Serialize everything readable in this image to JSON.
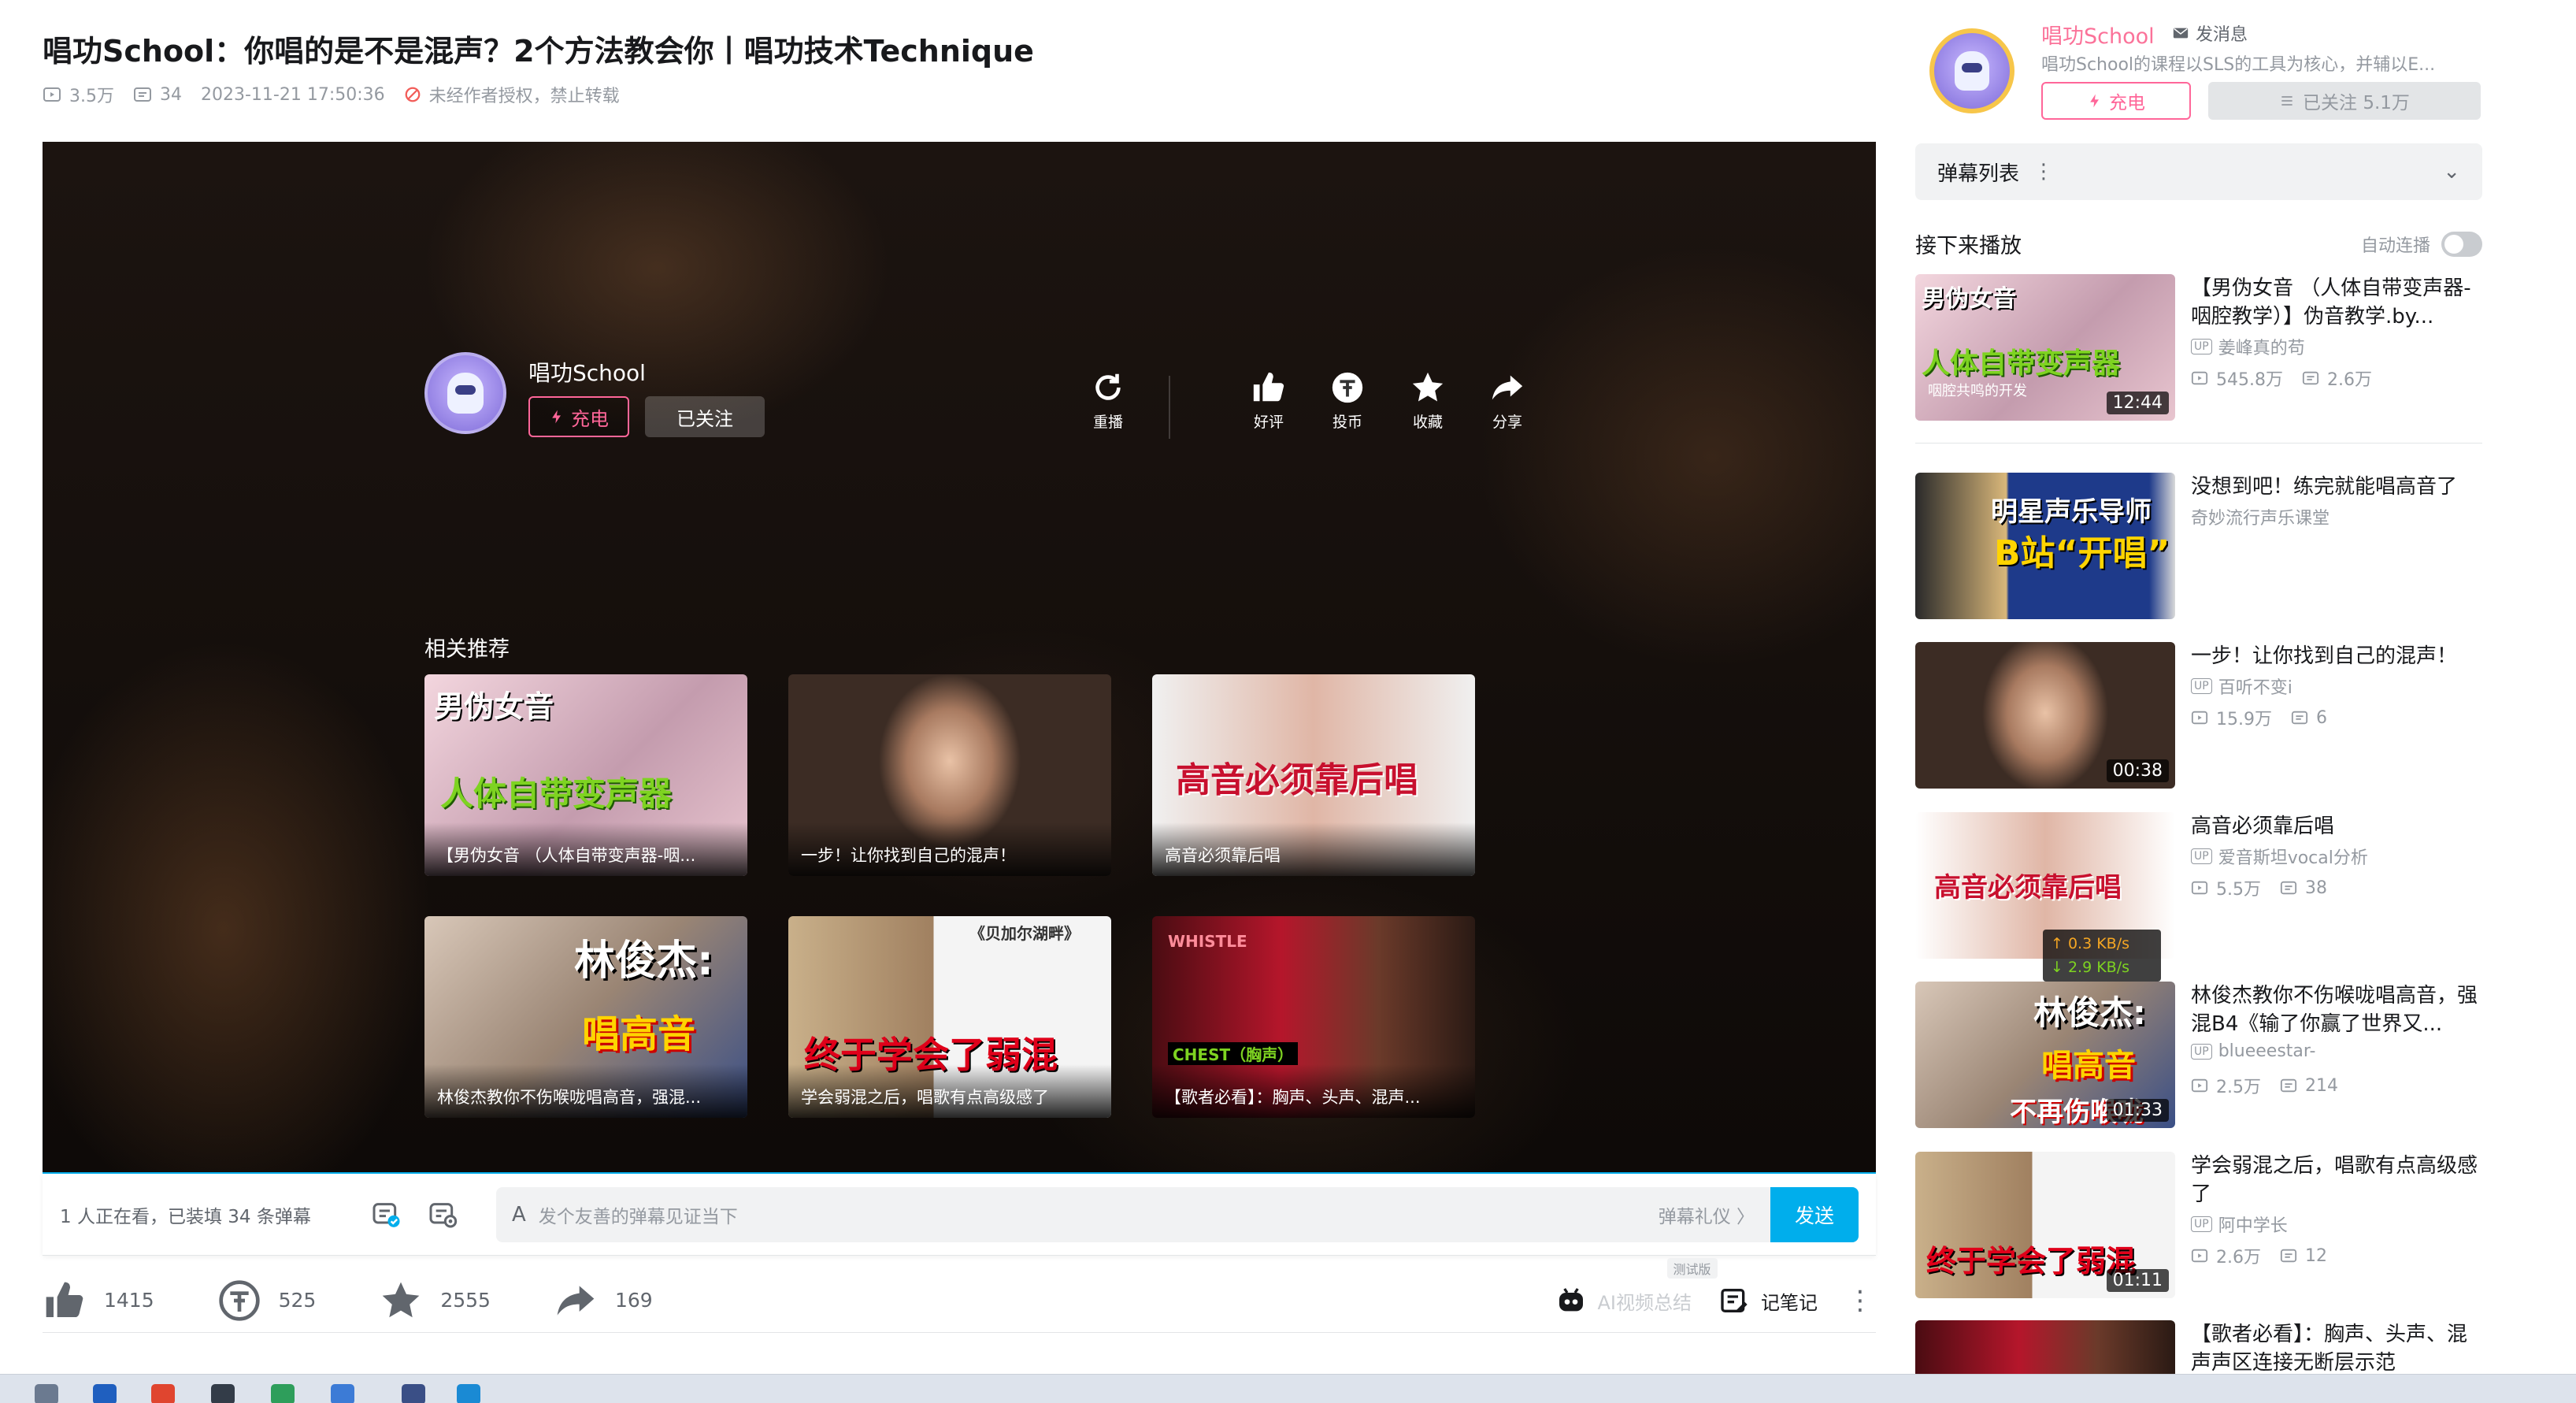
{
  "video": {
    "title": "唱功School：你唱的是不是混声？2个方法教会你丨唱功技术Technique",
    "views": "3.5万",
    "danmaku_count": "34",
    "datetime": "2023-11-21 17:50:36",
    "copyright": "未经作者授权，禁止转载"
  },
  "endcard": {
    "uploader": "唱功School",
    "charge": "充电",
    "followed": "已关注",
    "actions": [
      "重播",
      "好评",
      "投币",
      "收藏",
      "分享"
    ],
    "related_title": "相关推荐",
    "related": [
      {
        "caption": "【男伪女音 （人体自带变声器-咽...",
        "overlay": "男伪女音",
        "overlay2": "人体自带变声器"
      },
      {
        "caption": "一步！让你找到自己的混声！",
        "overlay": "",
        "overlay2": ""
      },
      {
        "caption": "高音必须靠后唱",
        "overlay": "高音必须靠后唱",
        "overlay2": ""
      },
      {
        "caption": "林俊杰教你不伤喉咙唱高音，强混...",
        "overlay": "林俊杰:",
        "overlay2": "唱高音"
      },
      {
        "caption": "学会弱混之后，唱歌有点高级感了",
        "overlay": "终于学会了弱混",
        "overlay2": "《贝加尔湖畔》"
      },
      {
        "caption": "【歌者必看】：胸声、头声、混声...",
        "overlay": "CHEST（胸声）",
        "overlay2": "WHISTLE"
      }
    ]
  },
  "danmaku_bar": {
    "watching": "1 人正在看，已装填 34 条弹幕",
    "input_icon": "A",
    "placeholder": "发个友善的弹幕见证当下",
    "gift": "弹幕礼仪 〉",
    "send": "发送"
  },
  "toolbar": {
    "like": "1415",
    "coin": "525",
    "favorite": "2555",
    "share": "169",
    "beta": "测试版",
    "ai_summary": "AI视频总结",
    "note": "记笔记",
    "more": "⋮"
  },
  "uploader_card": {
    "name": "唱功School",
    "message": "发消息",
    "description": "唱功School的课程以SLS的工具为核心，并辅以E...",
    "charge": "充电",
    "follow": "已关注 5.1万"
  },
  "danmaku_list": {
    "label": "弹幕列表",
    "dots": "⋮",
    "chevron": "⌄"
  },
  "next": {
    "title": "接下来播放",
    "autoplay": "自动连播"
  },
  "recommendations": [
    {
      "title": "【男伪女音 （人体自带变声器-咽腔教学）】伪音教学.by...",
      "author": "姜峰真的苟",
      "views": "545.8万",
      "danmaku": "2.6万",
      "duration": "12:44"
    },
    {
      "title": "没想到吧！练完就能唱高音了",
      "author": "奇妙流行声乐课堂",
      "views": "",
      "danmaku": "",
      "duration": ""
    },
    {
      "title": "一步！让你找到自己的混声！",
      "author": "百听不变i",
      "views": "15.9万",
      "danmaku": "6",
      "duration": "00:38"
    },
    {
      "title": "高音必须靠后唱",
      "author": "爱音斯坦vocal分析",
      "views": "5.5万",
      "danmaku": "38",
      "duration": ""
    },
    {
      "title": "林俊杰教你不伤喉咙唱高音，强混B4《输了你赢了世界又...",
      "author": "blueeestar-",
      "views": "2.5万",
      "danmaku": "214",
      "duration": "01:33"
    },
    {
      "title": "学会弱混之后，唱歌有点高级感了",
      "author": "阿中学长",
      "views": "2.6万",
      "danmaku": "12",
      "duration": "01:11"
    },
    {
      "title": "【歌者必看】：胸声、头声、混声声区连接无断层示范",
      "author": "",
      "views": "",
      "danmaku": "",
      "duration": ""
    }
  ],
  "thumb_text": {
    "rec1a": "男伪女音",
    "rec1b": "人体自带变声器",
    "rec1c": "咽腔共鸣的开发",
    "rec2a": "明星声乐导师",
    "rec2b": "B站“开唱”",
    "rec4a": "高音必须靠后唱",
    "rec5a": "林俊杰:",
    "rec5b": "唱高音",
    "rec5c": "不再伤喉咙",
    "rec6a": "终于学会了弱混"
  },
  "netspeed": {
    "up": "↑ 0.3 KB/s",
    "down": "↓ 2.9 KB/s"
  },
  "colors": {
    "accent": "#00aeec",
    "pink": "#fb7299",
    "text": "#18191c",
    "gray": "#9499a0"
  }
}
